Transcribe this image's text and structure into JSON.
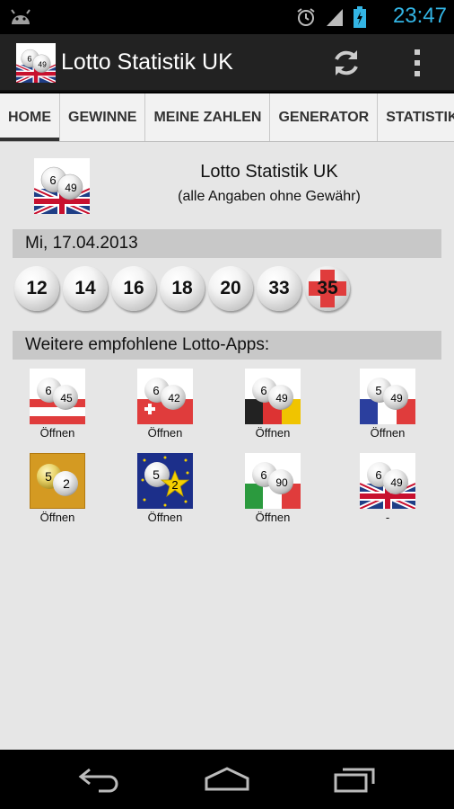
{
  "status_bar": {
    "time": "23:47",
    "icons": [
      "android-icon",
      "alarm-icon",
      "signal-icon",
      "battery-icon"
    ]
  },
  "action_bar": {
    "title": "Lotto Statistik UK",
    "icons": [
      "app-logo-uk",
      "refresh-icon",
      "overflow-menu-icon"
    ]
  },
  "tabs": [
    {
      "label": "HOME",
      "active": true
    },
    {
      "label": "GEWINNE",
      "active": false
    },
    {
      "label": "MEINE ZAHLEN",
      "active": false
    },
    {
      "label": "GENERATOR",
      "active": false
    },
    {
      "label": "STATISTIK",
      "active": false
    }
  ],
  "header": {
    "title": "Lotto Statistik UK",
    "subtitle": "(alle Angaben ohne Gewähr)"
  },
  "draw": {
    "date": "Mi, 17.04.2013",
    "numbers": [
      "12",
      "14",
      "16",
      "18",
      "20",
      "33"
    ],
    "bonus": "35"
  },
  "recommended": {
    "heading": "Weitere empfohlene Lotto-Apps:",
    "apps": [
      {
        "icon": "lotto-6-45-austria-icon",
        "n1": "6",
        "n2": "45",
        "label": "Öffnen"
      },
      {
        "icon": "lotto-6-42-switzerland-icon",
        "n1": "6",
        "n2": "42",
        "label": "Öffnen"
      },
      {
        "icon": "lotto-6-49-germany-icon",
        "n1": "6",
        "n2": "49",
        "label": "Öffnen"
      },
      {
        "icon": "lotto-5-49-france-icon",
        "n1": "5",
        "n2": "49",
        "label": "Öffnen"
      },
      {
        "icon": "lotto-5-2-gold-icon",
        "n1": "5",
        "n2": "2",
        "label": "Öffnen"
      },
      {
        "icon": "euromillions-5-2-icon",
        "n1": "5",
        "n2": "2",
        "label": "Öffnen"
      },
      {
        "icon": "lotto-6-90-italy-icon",
        "n1": "6",
        "n2": "90",
        "label": "Öffnen"
      },
      {
        "icon": "lotto-6-49-uk-icon",
        "n1": "6",
        "n2": "49",
        "label": "-"
      }
    ]
  },
  "nav_bar": {
    "icons": [
      "back-icon",
      "home-icon",
      "recent-apps-icon"
    ]
  },
  "colors": {
    "accent": "#33b5e5",
    "action_bar": "#222222",
    "content_bg": "#e6e6e6",
    "band_bg": "#c8c8c8"
  }
}
